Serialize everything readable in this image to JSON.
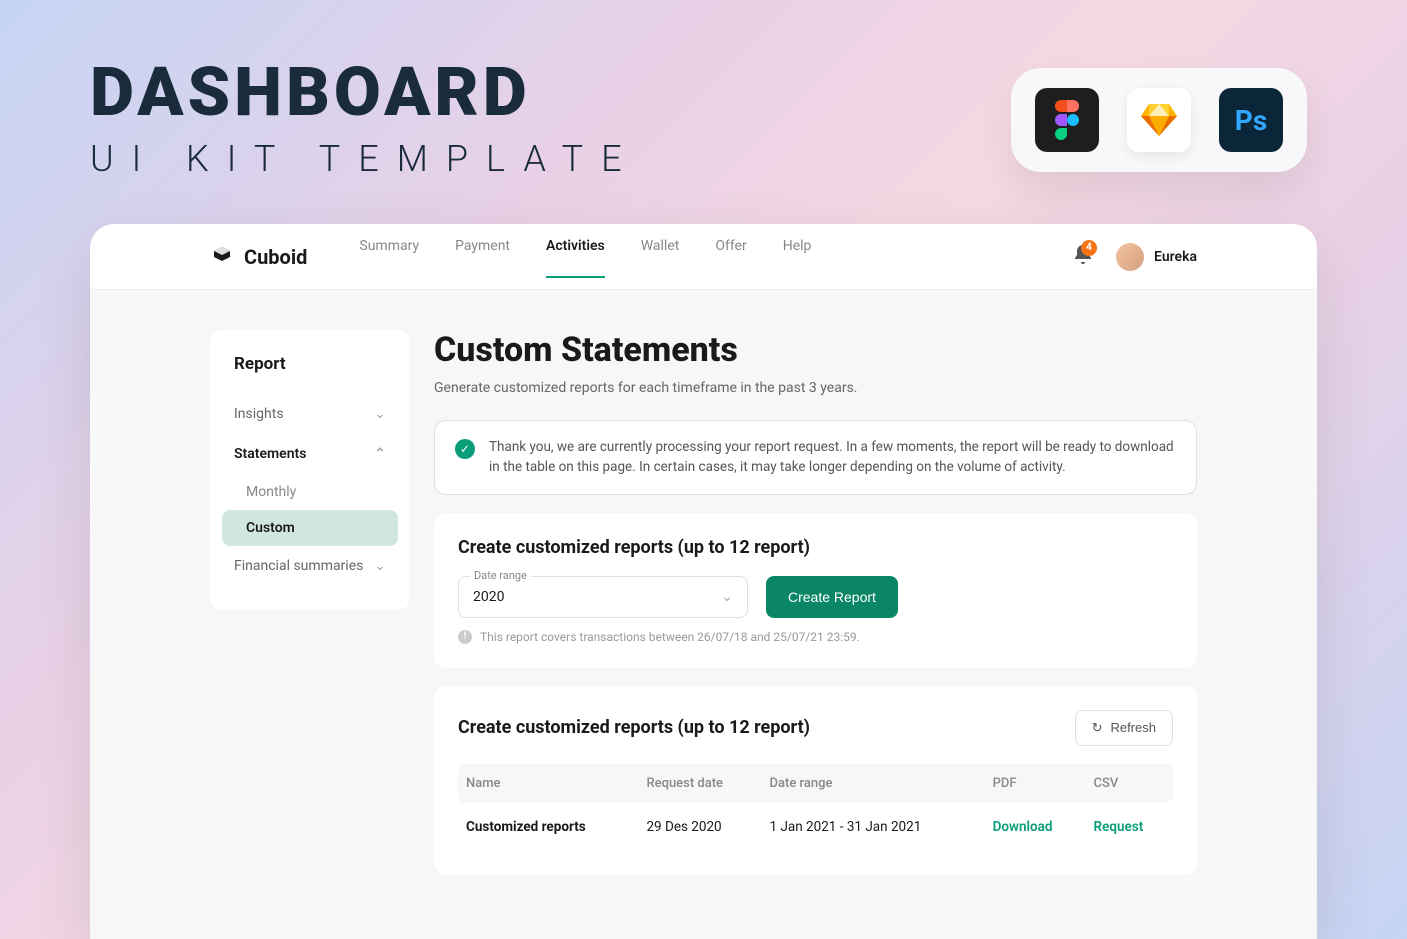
{
  "promo": {
    "title": "DASHBOARD",
    "subtitle": "UI KIT TEMPLATE"
  },
  "topbar": {
    "brand": "Cuboid",
    "nav": {
      "summary": "Summary",
      "payment": "Payment",
      "activities": "Activities",
      "wallet": "Wallet",
      "offer": "Offer",
      "help": "Help"
    },
    "notifications_count": "4",
    "username": "Eureka"
  },
  "sidebar": {
    "title": "Report",
    "insights": "Insights",
    "statements": "Statements",
    "monthly": "Monthly",
    "custom": "Custom",
    "financial": "Financial summaries"
  },
  "page": {
    "title": "Custom Statements",
    "subtitle": "Generate customized reports for each timeframe in the past 3 years."
  },
  "alert": {
    "text": "Thank you, we are currently processing your report request. In a few moments, the report will be ready to download in the table on this page. In certain cases, it may take longer depending on the volume of activity."
  },
  "create_card": {
    "title": "Create customized reports (up to 12 report)",
    "date_range_label": "Date range",
    "date_range_value": "2020",
    "create_button": "Create Report",
    "hint": "This report covers transactions between 26/07/18 and 25/07/21 23:59."
  },
  "table_card": {
    "title": "Create customized reports (up to 12 report)",
    "refresh": "Refresh",
    "headers": {
      "name": "Name",
      "request_date": "Request date",
      "date_range": "Date range",
      "pdf": "PDF",
      "csv": "CSV"
    },
    "rows": [
      {
        "name": "Customized reports",
        "request_date": "29 Des 2020",
        "date_range": "1 Jan 2021 - 31 Jan 2021",
        "pdf": "Download",
        "csv": "Request"
      }
    ]
  }
}
